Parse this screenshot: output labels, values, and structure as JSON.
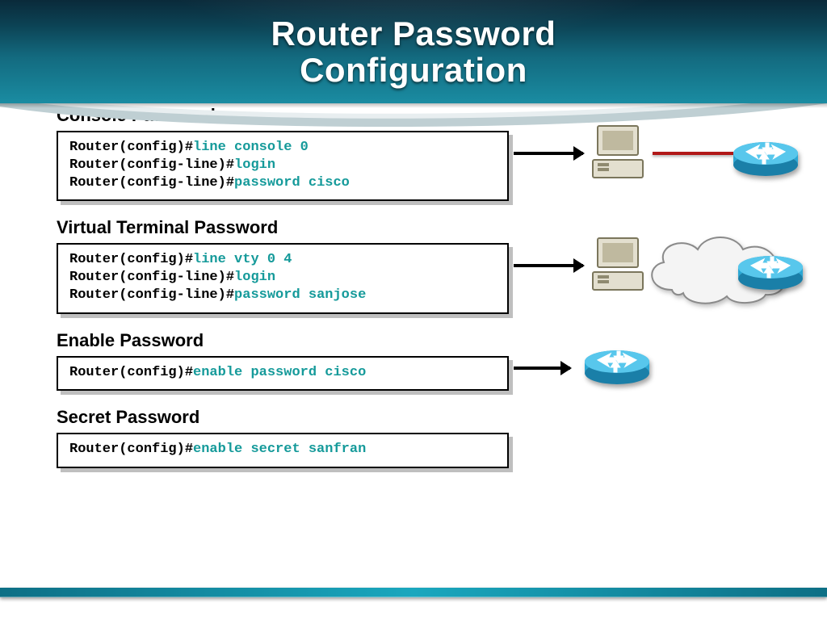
{
  "title": "Router Password Configuration",
  "sections": {
    "console": {
      "heading": "Console Password",
      "lines": [
        {
          "prompt": "Router(config)#",
          "cmd": "line console 0"
        },
        {
          "prompt": "Router(config-line)#",
          "cmd": "login"
        },
        {
          "prompt": "Router(config-line)#",
          "cmd": "password cisco"
        }
      ]
    },
    "vty": {
      "heading": "Virtual Terminal Password",
      "lines": [
        {
          "prompt": "Router(config)#",
          "cmd": "line vty 0 4"
        },
        {
          "prompt": "Router(config-line)#",
          "cmd": "login"
        },
        {
          "prompt": "Router(config-line)#",
          "cmd": "password sanjose"
        }
      ]
    },
    "enable": {
      "heading": "Enable Password",
      "lines": [
        {
          "prompt": "Router(config)#",
          "cmd": "enable password cisco"
        }
      ]
    },
    "secret": {
      "heading": "Secret Password",
      "lines": [
        {
          "prompt": "Router(config)#",
          "cmd": "enable secret sanfran"
        }
      ]
    }
  },
  "icons": {
    "pc": "workstation-icon",
    "router": "router-icon",
    "cloud": "network-cloud-icon"
  },
  "colors": {
    "cmd": "#159a9a",
    "prompt": "#000000",
    "accent_band": "#1aa7be"
  }
}
